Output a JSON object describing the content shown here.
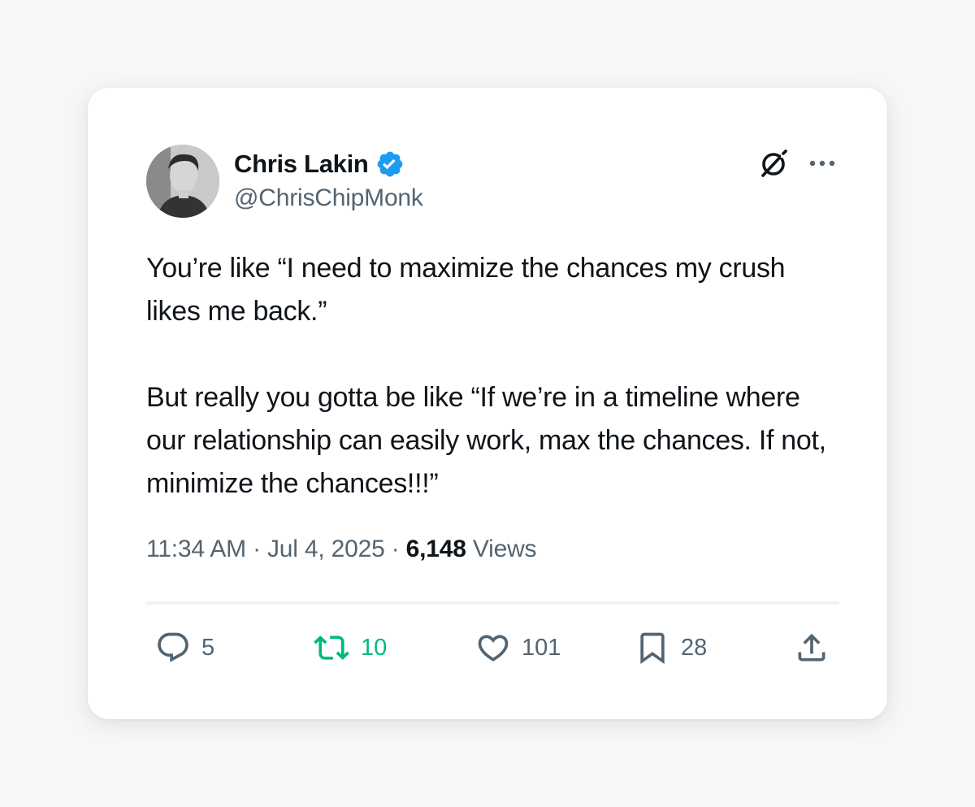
{
  "tweet": {
    "author": {
      "name": "Chris Lakin",
      "handle": "@ChrisChipMonk",
      "verified": true,
      "verified_color": "#1d9bf0"
    },
    "text": "You’re like “I need to maximize the chances my crush likes me back.”\n\nBut really you gotta be like “If we’re in a timeline where our relationship can easily work, max the chances. If not, minimize the chances!!!”",
    "time": "11:34 AM",
    "separator": " · ",
    "date": "Jul 4, 2025",
    "views_count": "6,148",
    "views_label": " Views",
    "header_icons": [
      "grok-icon",
      "more-icon"
    ],
    "actions": {
      "reply": {
        "icon": "reply-icon",
        "count": "5"
      },
      "retweet": {
        "icon": "retweet-icon",
        "count": "10",
        "active": true,
        "color": "#00ba7c"
      },
      "like": {
        "icon": "heart-icon",
        "count": "101"
      },
      "bookmark": {
        "icon": "bookmark-icon",
        "count": "28"
      },
      "share": {
        "icon": "share-icon"
      }
    }
  },
  "colors": {
    "text_primary": "#0f1419",
    "text_secondary": "#536471",
    "background": "#f7f7f7",
    "card": "#ffffff"
  }
}
